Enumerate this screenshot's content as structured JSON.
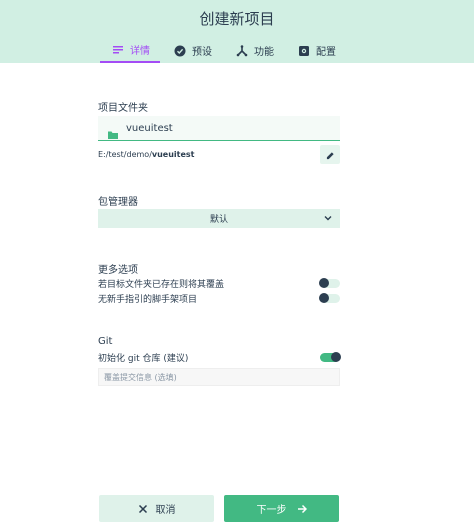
{
  "header": {
    "title": "创建新项目",
    "tabs": [
      {
        "label": "详情",
        "icon": "details-list-icon",
        "active": true
      },
      {
        "label": "预设",
        "icon": "check-circle-icon",
        "active": false
      },
      {
        "label": "功能",
        "icon": "merge-icon",
        "active": false
      },
      {
        "label": "配置",
        "icon": "settings-icon",
        "active": false
      }
    ]
  },
  "folder": {
    "label": "项目文件夹",
    "value": "vueuitest",
    "path_prefix": "E:/test/demo/",
    "path_name": "vueuitest"
  },
  "package_manager": {
    "label": "包管理器",
    "selected": "默认"
  },
  "more_options": {
    "label": "更多选项",
    "items": [
      {
        "label": "若目标文件夹已存在则将其覆盖",
        "on": false
      },
      {
        "label": "无新手指引的脚手架项目",
        "on": false
      }
    ]
  },
  "git": {
    "label": "Git",
    "init_label": "初始化 git 仓库 (建议)",
    "init_on": true,
    "commit_placeholder": "覆盖提交信息 (选填)"
  },
  "footer": {
    "cancel_label": "取消",
    "next_label": "下一步"
  },
  "colors": {
    "accent": "#42b983",
    "header_bg": "#d1efe3",
    "active_tab": "#a44cf5",
    "text": "#2c3e50"
  }
}
